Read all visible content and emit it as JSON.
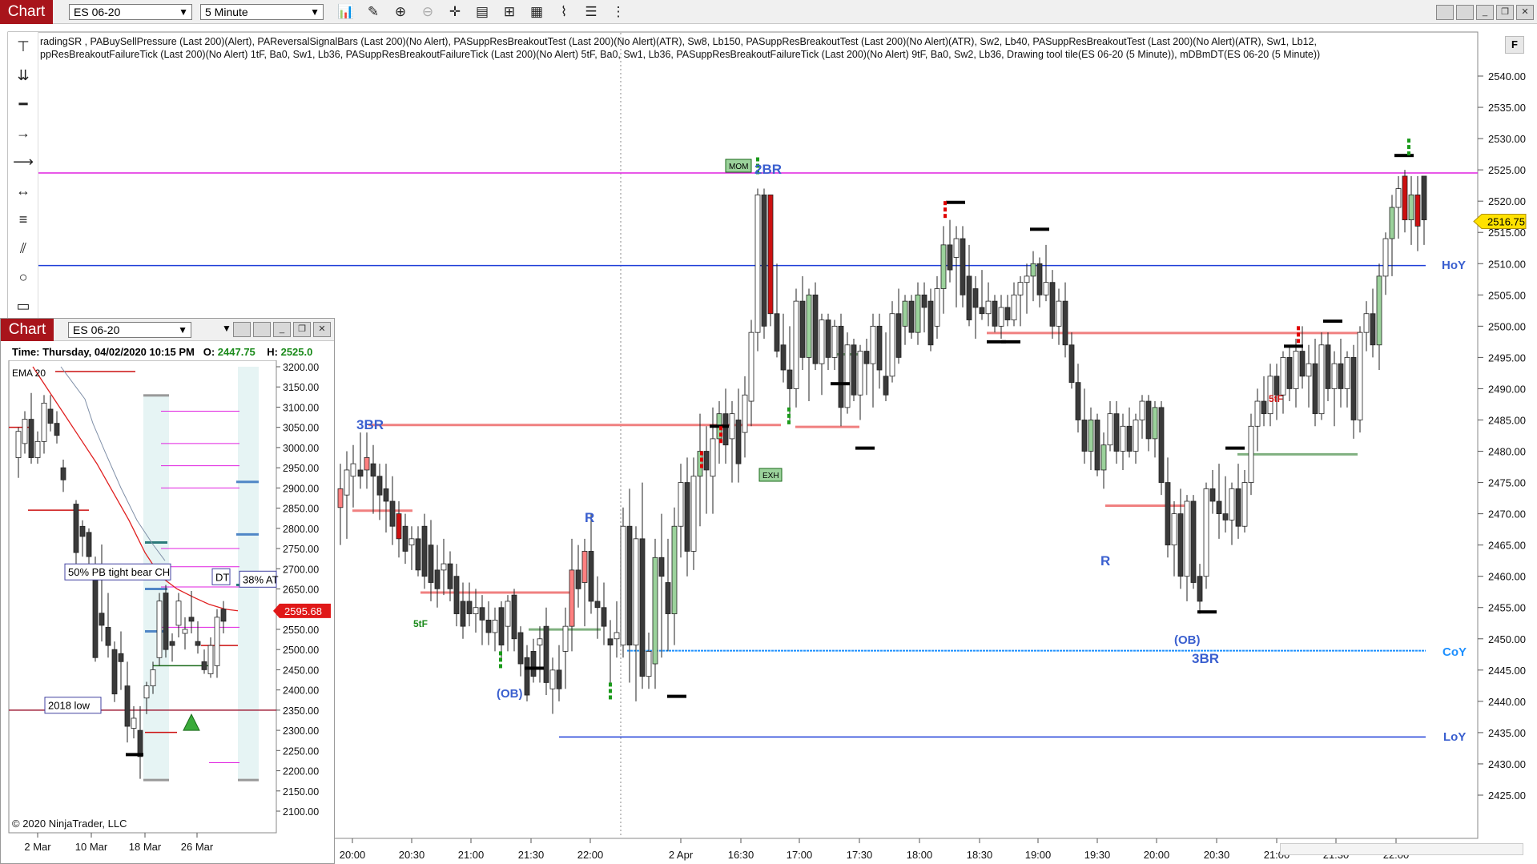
{
  "toolbar": {
    "chart_tab": "Chart",
    "instrument": "ES 06-20",
    "interval": "5 Minute",
    "icons": [
      "bar-type-icon",
      "pencil-icon",
      "zoom-in-icon",
      "zoom-out-icon",
      "crosshair-icon",
      "properties-icon",
      "indicators-icon",
      "strategies-icon",
      "analyzer-icon",
      "list-icon"
    ],
    "window_buttons": [
      "minimize-icon",
      "restore-icon",
      "maximize-icon",
      "close-icon"
    ]
  },
  "indicator_line1": "radingSR , PABuySellPressure (Last 200)(Alert), PAReversalSignalBars (Last 200)(No Alert), PASuppResBreakoutTest (Last 200)(No Alert)(ATR),  Sw8,  Lb150, PASuppResBreakoutTest (Last 200)(No Alert)(ATR),  Sw2,  Lb40, PASuppResBreakoutTest (Last 200)(No Alert)(ATR),  Sw1,  Lb12,",
  "indicator_line2": "ppResBreakoutFailureTick (Last 200)(No Alert) 1tF,  Ba0,  Sw1,  Lb36, PASuppResBreakoutFailureTick (Last 200)(No Alert) 5tF,  Ba0,  Sw1,  Lb36, PASuppResBreakoutFailureTick (Last 200)(No Alert) 9tF,  Ba0,  Sw2,  Lb36, Drawing tool tile(ES 06-20 (5 Minute)), mDBmDT(ES 06-20 (5 Minute))",
  "f_button": "F",
  "main_chart": {
    "y_ticks": [
      "2540.00",
      "2535.00",
      "2530.00",
      "2525.00",
      "2520.00",
      "2515.00",
      "2510.00",
      "2505.00",
      "2500.00",
      "2495.00",
      "2490.00",
      "2485.00",
      "2480.00",
      "2475.00",
      "2470.00",
      "2465.00",
      "2460.00",
      "2455.00",
      "2450.00",
      "2445.00",
      "2440.00",
      "2435.00",
      "2430.00",
      "2425.00"
    ],
    "x_ticks": [
      "20:00",
      "20:30",
      "21:00",
      "21:30",
      "22:00",
      "2 Apr",
      "16:30",
      "17:00",
      "17:30",
      "18:00",
      "18:30",
      "19:00",
      "19:30",
      "20:00",
      "20:30",
      "21:00",
      "21:30",
      "22:00"
    ],
    "last_price": "2516.75",
    "level_labels": {
      "hoy": "HoY",
      "loy": "LoY",
      "coy": "CoY"
    },
    "annotations": {
      "br3_left": "3BR",
      "br2": "2BR",
      "r_left": "R",
      "r_right": "R",
      "ob_left": "(OB)",
      "ob_right": "(OB)",
      "br3_right": "3BR",
      "stf_left": "5tF",
      "stf_right": "5tF",
      "mom": "MOM",
      "exh": "EXH"
    },
    "colors": {
      "magenta": "#e020e0",
      "blue": "#1f3fd8",
      "red_level": "#f08080",
      "green_level": "#7fb07f",
      "coy": "#1e90ff"
    }
  },
  "sub_chart": {
    "chart_tab": "Chart",
    "instrument": "ES 06-20",
    "time_label": "Time:",
    "time_value": "Thursday, 04/02/2020 10:15 PM",
    "open_label": "O:",
    "open_value": "2447.75",
    "high_label": "H:",
    "high_value": "2525.0",
    "ema_label": "EMA",
    "ema_period": "20",
    "y_ticks": [
      "3200.00",
      "3150.00",
      "3100.00",
      "3050.00",
      "3000.00",
      "2950.00",
      "2900.00",
      "2850.00",
      "2800.00",
      "2750.00",
      "2700.00",
      "2650.00",
      "2600.00",
      "2550.00",
      "2500.00",
      "2450.00",
      "2400.00",
      "2350.00",
      "2300.00",
      "2250.00",
      "2200.00",
      "2150.00",
      "2100.00"
    ],
    "x_ticks": [
      "2 Mar",
      "10 Mar",
      "18 Mar",
      "26 Mar"
    ],
    "last_price": "2595.68",
    "notes": {
      "pb": "50% PB tight bear CH",
      "dt": "DT",
      "at": "38% AT",
      "low2018": "2018 low"
    },
    "copyright": "© 2020 NinjaTrader, LLC"
  }
}
